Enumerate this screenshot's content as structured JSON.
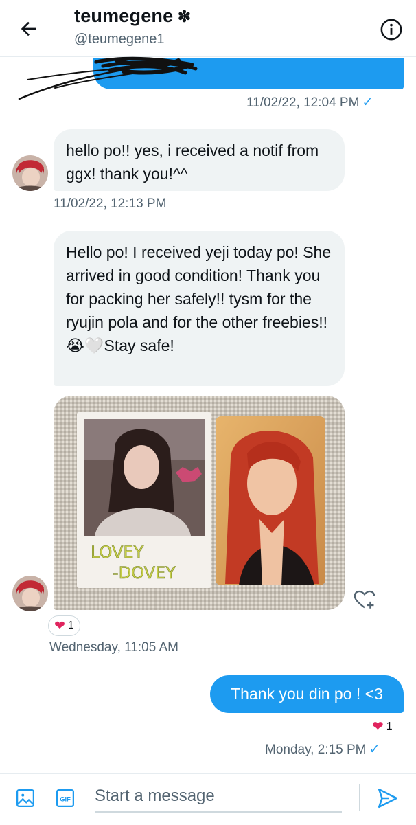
{
  "header": {
    "title": "teumegene",
    "title_emoji": "✽",
    "handle": "@teumegene1",
    "back_icon": "arrow-left-icon",
    "info_icon": "info-icon"
  },
  "messages": {
    "sent_top_timestamp": "11/02/22, 12:04 PM",
    "received_1_text": "hello po!! yes, i received a notif from ggx! thank you!^^",
    "received_1_timestamp": "11/02/22, 12:13 PM",
    "received_2_text": "Hello po! I received yeji today po! She arrived in good condition! Thank you for packing her safely!! tysm for the ryujin pola and for the other freebies!!😭🤍Stay safe!",
    "photo_polaroid_text_1": "LOVEY",
    "photo_polaroid_text_2": "-DOVEY",
    "photo_reaction_count": "1",
    "photo_timestamp": "Wednesday, 11:05 AM",
    "sent_2_text": "Thank you din po ! <3",
    "sent_2_reaction_count": "1",
    "sent_2_timestamp": "Monday, 2:15 PM"
  },
  "composer": {
    "placeholder": "Start a message",
    "gif_label": "GIF"
  },
  "colors": {
    "accent": "#1d9bf0",
    "incoming_bubble": "#eff3f4",
    "secondary_text": "#536471",
    "heart": "#e0245e"
  }
}
